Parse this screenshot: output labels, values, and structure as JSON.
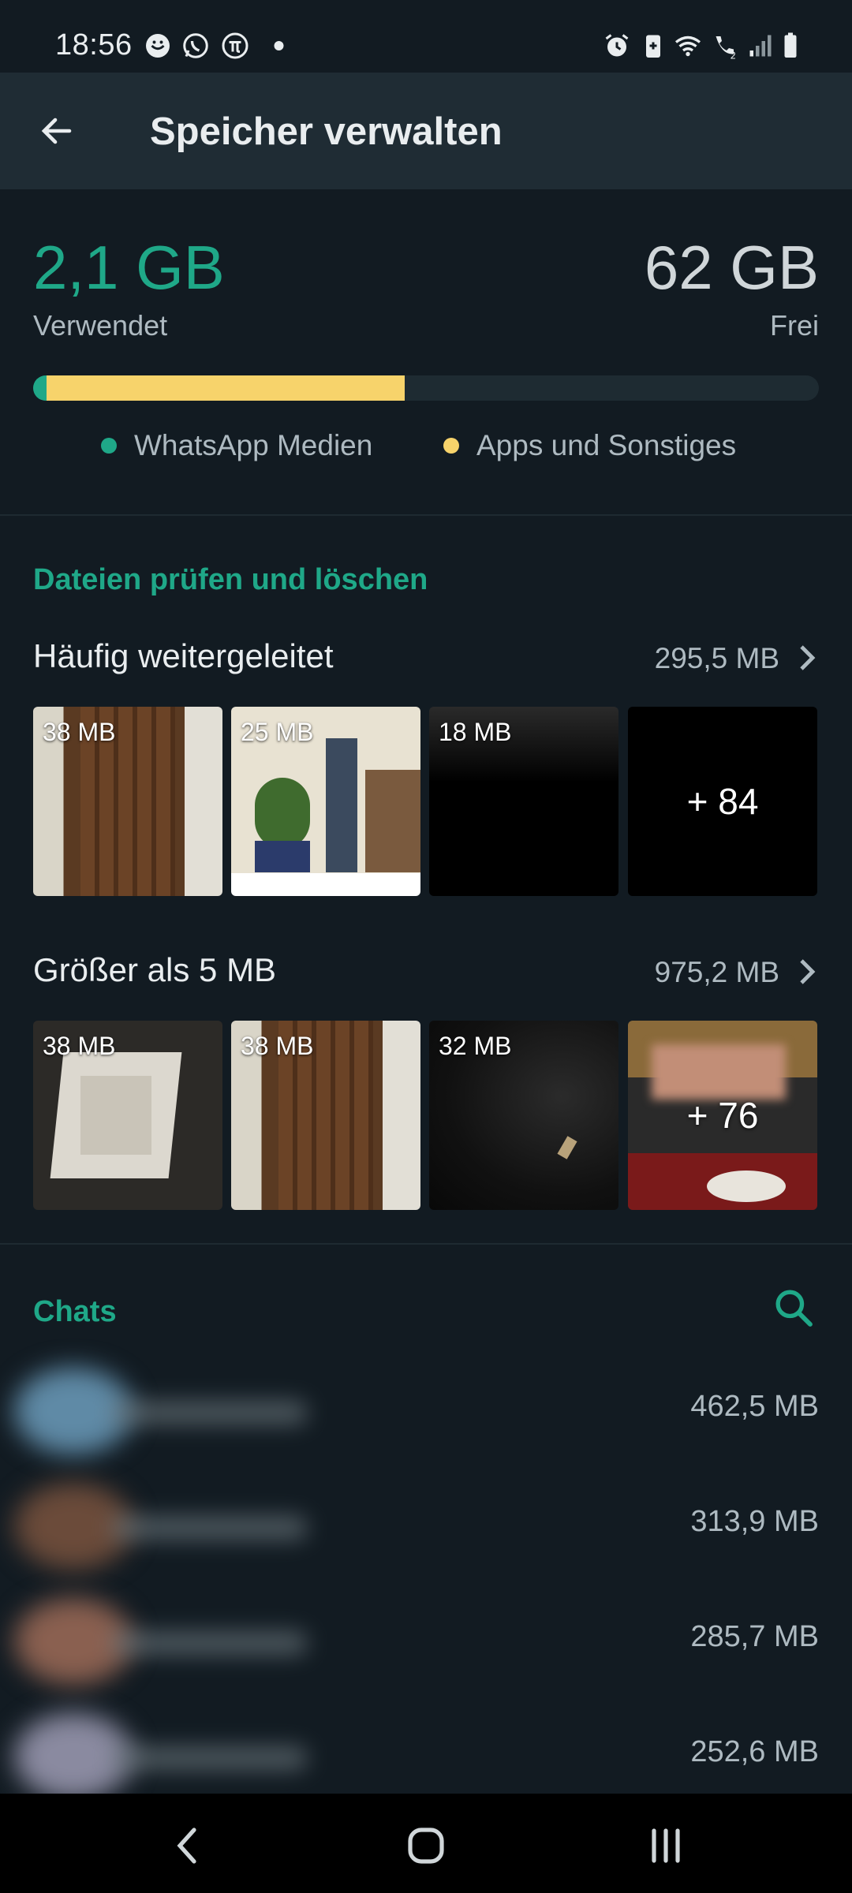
{
  "status_bar": {
    "time": "18:56",
    "icons": [
      "smiley-icon",
      "whatsapp-icon",
      "pi-icon",
      "dot-icon",
      "alarm-icon",
      "battery-saver-icon",
      "wifi-icon",
      "wifi-calling-icon",
      "signal-icon",
      "battery-icon"
    ]
  },
  "app_bar": {
    "title": "Speicher verwalten",
    "back_icon": "back-arrow-icon"
  },
  "storage": {
    "used_value": "2,1 GB",
    "used_label": "Verwendet",
    "free_value": "62 GB",
    "free_label": "Frei",
    "bar": {
      "whatsapp_fraction": 0.017,
      "apps_fraction": 0.456
    },
    "legend": [
      {
        "label": "WhatsApp Medien",
        "color": "#1fa888"
      },
      {
        "label": "Apps und Sonstiges",
        "color": "#f7d36b"
      }
    ]
  },
  "review": {
    "section_title": "Dateien prüfen und löschen",
    "forwarded": {
      "title": "Häufig weitergeleitet",
      "size": "295,5 MB",
      "thumbs": [
        {
          "label": "38 MB"
        },
        {
          "label": "25 MB"
        },
        {
          "label": "18 MB"
        },
        {
          "label": "",
          "more": "+ 84"
        }
      ]
    },
    "large": {
      "title": "Größer als 5 MB",
      "size": "975,2 MB",
      "thumbs": [
        {
          "label": "38 MB"
        },
        {
          "label": "38 MB"
        },
        {
          "label": "32 MB"
        },
        {
          "label": "",
          "more": "+ 76"
        }
      ]
    }
  },
  "chats": {
    "section_title": "Chats",
    "search_icon": "search-icon",
    "items": [
      {
        "size": "462,5 MB"
      },
      {
        "size": "313,9 MB"
      },
      {
        "size": "285,7 MB"
      },
      {
        "size": "252,6 MB"
      }
    ]
  },
  "nav_bar": {
    "icons": [
      "nav-back-icon",
      "nav-home-icon",
      "nav-recents-icon"
    ]
  },
  "colors": {
    "accent": "#1fa888",
    "apps": "#f7d36b",
    "background": "#121b22",
    "appbar": "#1f2c34"
  }
}
